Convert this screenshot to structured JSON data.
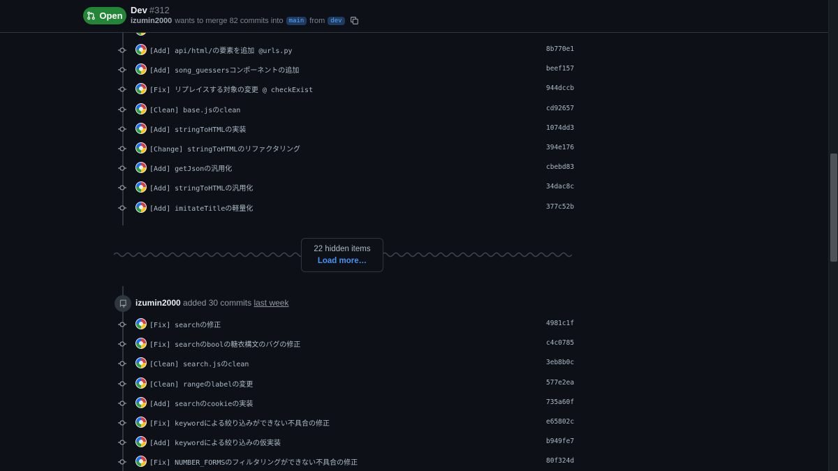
{
  "header": {
    "state": "Open",
    "title": "Dev",
    "number": "#312",
    "author": "izumin2000",
    "merge_text": "wants to merge 82 commits into",
    "base_branch": "main",
    "from_text": "from",
    "head_branch": "dev"
  },
  "commits_top": [
    {
      "message": "[Add] api/html/の要素を追加 @urls.py",
      "sha": "8b770e1"
    },
    {
      "message": "[Add] song_guessersコンポーネントの追加",
      "sha": "beef157"
    },
    {
      "message": "[Fix] リプレイスする対象の変更 @ checkExist",
      "sha": "944dccb"
    },
    {
      "message": "[Clean] base.jsのclean",
      "sha": "cd92657"
    },
    {
      "message": "[Add] stringToHTMLの実装",
      "sha": "1074dd3"
    },
    {
      "message": "[Change] stringToHTMLのリファクタリング",
      "sha": "394e176"
    },
    {
      "message": "[Add] getJsonの汎用化",
      "sha": "cbebd83"
    },
    {
      "message": "[Add] stringToHTMLの汎用化",
      "sha": "34dac8c"
    },
    {
      "message": "[Add] imitateTitleの軽量化",
      "sha": "377c52b"
    }
  ],
  "hidden": {
    "count_text": "22 hidden items",
    "load_more": "Load more…"
  },
  "event": {
    "author": "izumin2000",
    "action": "added 30 commits",
    "when": "last week"
  },
  "commits_bottom": [
    {
      "message": "[Fix] searchの修正",
      "sha": "4981c1f"
    },
    {
      "message": "[Fix] searchのboolの糖衣構文のバグの修正",
      "sha": "c4c0785"
    },
    {
      "message": "[Clean] search.jsのclean",
      "sha": "3eb8b0c"
    },
    {
      "message": "[Clean] rangeのlabelの変更",
      "sha": "577e2ea"
    },
    {
      "message": "[Add] searchのcookieの実装",
      "sha": "735a60f"
    },
    {
      "message": "[Fix] keywordによる絞り込みができない不具合の修正",
      "sha": "e65802c"
    },
    {
      "message": "[Add] keywordによる絞り込みの仮実装",
      "sha": "b949fe7"
    },
    {
      "message": "[Fix] NUMBER_FORMSのフィルタリングができない不具合の修正",
      "sha": "80f324d"
    }
  ],
  "colors": {
    "open_badge": "#238636",
    "link": "#4493f8",
    "background": "#0d1117"
  }
}
